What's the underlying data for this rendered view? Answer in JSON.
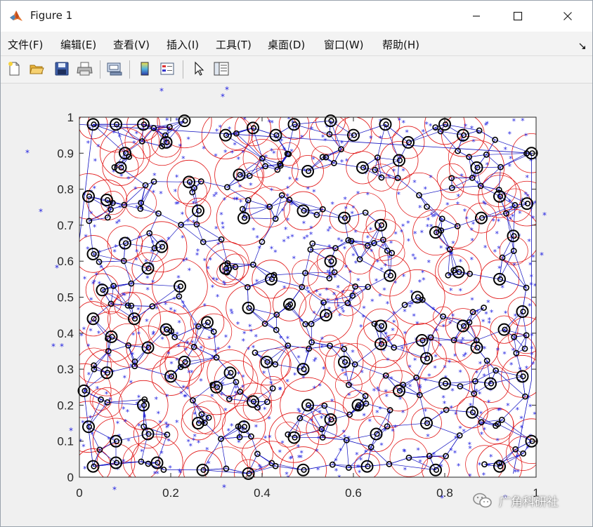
{
  "window": {
    "title": "Figure 1",
    "minimize_icon": "minimize-icon",
    "maximize_icon": "maximize-icon",
    "close_icon": "close-icon"
  },
  "menu": {
    "items": [
      "文件(F)",
      "编辑(E)",
      "查看(V)",
      "插入(I)",
      "工具(T)",
      "桌面(D)",
      "窗口(W)",
      "帮助(H)"
    ],
    "dock_arrow": "↘"
  },
  "toolbar": {
    "icons": [
      "new-figure-icon",
      "open-file-icon",
      "save-icon",
      "print-icon",
      "link-plot-icon",
      "insert-colorbar-icon",
      "insert-legend-icon",
      "edit-plot-arrow-icon",
      "property-inspector-icon"
    ]
  },
  "chart_data": {
    "type": "scatter",
    "title": "",
    "xlabel": "",
    "ylabel": "",
    "xlim": [
      0,
      1
    ],
    "ylim": [
      0,
      1
    ],
    "x_ticks": [
      "0",
      "0.2",
      "0.4",
      "0.6",
      "0.8",
      "1"
    ],
    "y_ticks": [
      "0",
      "0.1",
      "0.2",
      "0.3",
      "0.4",
      "0.5",
      "0.6",
      "0.7",
      "0.8",
      "0.9",
      "1"
    ],
    "grid": false,
    "colors": {
      "sensor_points": "#1f1fe0",
      "coverage_circles": "#e01010",
      "links": "#1010c0",
      "nodes": "#000000"
    },
    "series_nodes_at": [
      [
        0.03,
        0.98
      ],
      [
        0.08,
        0.98
      ],
      [
        0.14,
        0.98
      ],
      [
        0.23,
        0.99
      ],
      [
        0.38,
        0.97
      ],
      [
        0.47,
        0.98
      ],
      [
        0.55,
        0.99
      ],
      [
        0.67,
        0.98
      ],
      [
        0.8,
        0.98
      ],
      [
        0.99,
        0.9
      ],
      [
        0.1,
        0.9
      ],
      [
        0.19,
        0.93
      ],
      [
        0.32,
        0.95
      ],
      [
        0.43,
        0.95
      ],
      [
        0.6,
        0.95
      ],
      [
        0.72,
        0.93
      ],
      [
        0.84,
        0.95
      ],
      [
        0.02,
        0.78
      ],
      [
        0.06,
        0.77
      ],
      [
        0.09,
        0.86
      ],
      [
        0.24,
        0.82
      ],
      [
        0.35,
        0.84
      ],
      [
        0.5,
        0.85
      ],
      [
        0.62,
        0.86
      ],
      [
        0.7,
        0.88
      ],
      [
        0.87,
        0.86
      ],
      [
        0.92,
        0.78
      ],
      [
        0.98,
        0.76
      ],
      [
        0.03,
        0.62
      ],
      [
        0.1,
        0.65
      ],
      [
        0.18,
        0.64
      ],
      [
        0.26,
        0.74
      ],
      [
        0.36,
        0.72
      ],
      [
        0.49,
        0.74
      ],
      [
        0.58,
        0.72
      ],
      [
        0.66,
        0.7
      ],
      [
        0.78,
        0.68
      ],
      [
        0.88,
        0.72
      ],
      [
        0.95,
        0.67
      ],
      [
        0.05,
        0.52
      ],
      [
        0.15,
        0.58
      ],
      [
        0.22,
        0.53
      ],
      [
        0.32,
        0.58
      ],
      [
        0.42,
        0.55
      ],
      [
        0.55,
        0.6
      ],
      [
        0.68,
        0.56
      ],
      [
        0.74,
        0.5
      ],
      [
        0.83,
        0.57
      ],
      [
        0.92,
        0.55
      ],
      [
        0.97,
        0.46
      ],
      [
        0.03,
        0.44
      ],
      [
        0.12,
        0.44
      ],
      [
        0.19,
        0.41
      ],
      [
        0.28,
        0.43
      ],
      [
        0.37,
        0.47
      ],
      [
        0.46,
        0.48
      ],
      [
        0.54,
        0.45
      ],
      [
        0.66,
        0.42
      ],
      [
        0.75,
        0.38
      ],
      [
        0.84,
        0.42
      ],
      [
        0.93,
        0.41
      ],
      [
        0.07,
        0.39
      ],
      [
        0.15,
        0.36
      ],
      [
        0.23,
        0.32
      ],
      [
        0.33,
        0.29
      ],
      [
        0.41,
        0.32
      ],
      [
        0.49,
        0.3
      ],
      [
        0.58,
        0.32
      ],
      [
        0.66,
        0.37
      ],
      [
        0.76,
        0.33
      ],
      [
        0.87,
        0.36
      ],
      [
        0.97,
        0.28
      ],
      [
        0.01,
        0.24
      ],
      [
        0.06,
        0.29
      ],
      [
        0.14,
        0.2
      ],
      [
        0.2,
        0.28
      ],
      [
        0.3,
        0.25
      ],
      [
        0.38,
        0.21
      ],
      [
        0.5,
        0.2
      ],
      [
        0.61,
        0.2
      ],
      [
        0.7,
        0.24
      ],
      [
        0.8,
        0.26
      ],
      [
        0.9,
        0.26
      ],
      [
        0.02,
        0.14
      ],
      [
        0.08,
        0.1
      ],
      [
        0.15,
        0.12
      ],
      [
        0.26,
        0.15
      ],
      [
        0.36,
        0.14
      ],
      [
        0.47,
        0.11
      ],
      [
        0.55,
        0.16
      ],
      [
        0.65,
        0.12
      ],
      [
        0.76,
        0.15
      ],
      [
        0.86,
        0.18
      ],
      [
        0.99,
        0.1
      ],
      [
        0.03,
        0.03
      ],
      [
        0.08,
        0.04
      ],
      [
        0.17,
        0.04
      ],
      [
        0.27,
        0.02
      ],
      [
        0.37,
        0.01
      ],
      [
        0.49,
        0.02
      ],
      [
        0.63,
        0.03
      ],
      [
        0.78,
        0.02
      ],
      [
        0.92,
        0.03
      ]
    ]
  },
  "watermark": {
    "text": "广角科研社",
    "icon": "wechat-icon"
  }
}
